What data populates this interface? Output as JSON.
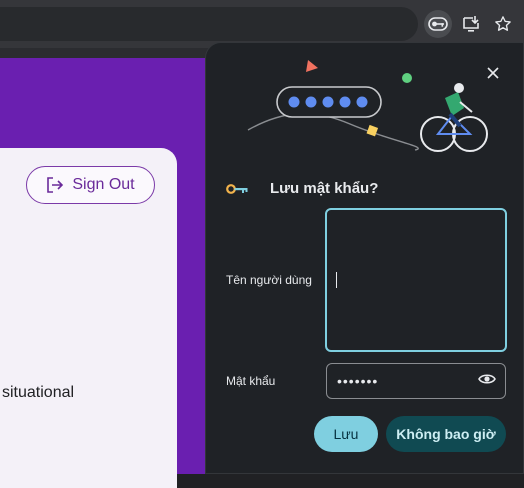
{
  "toolbar": {
    "icons": [
      "password-key-icon",
      "install-app-icon",
      "bookmark-star-icon"
    ]
  },
  "page": {
    "signout_label": "Sign Out",
    "body_fragment": "situational"
  },
  "bubble": {
    "title": "Lưu mật khẩu?",
    "username_label": "Tên người dùng",
    "username_value": "",
    "password_label": "Mật khẩu",
    "password_value": "•••••••",
    "save_label": "Lưu",
    "never_label": "Không bao giờ",
    "icons": [
      "close-icon",
      "key-icon",
      "eye-icon"
    ]
  },
  "colors": {
    "purple_bg": "#6a1fb0",
    "bubble_bg": "#1f2226",
    "accent_cyan": "#7fcfe0",
    "never_btn": "#104a52"
  }
}
